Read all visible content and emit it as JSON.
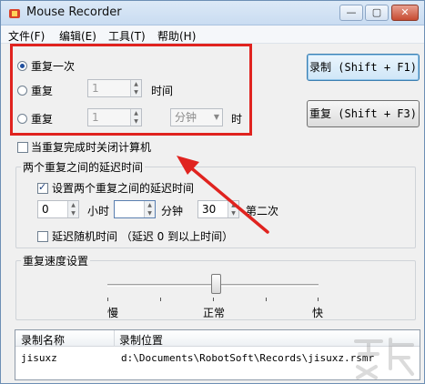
{
  "window": {
    "title": "Mouse Recorder",
    "buttons": {
      "min": "—",
      "max": "▢",
      "close": "✕"
    }
  },
  "menu": [
    "文件(F)",
    "编辑(E)",
    "工具(T)",
    "帮助(H)"
  ],
  "repeat": {
    "once_label": "重复一次",
    "times_label": "重复",
    "times_value": "1",
    "times_unit": "时间",
    "duration_label": "重复",
    "duration_value": "1",
    "duration_unit_option": "分钟",
    "duration_suffix": "时"
  },
  "buttons": {
    "record": "录制 (Shift + F1)",
    "repeat": "重复 (Shift + F3)"
  },
  "shutdown_label": "当重复完成时关闭计算机",
  "delay_group": {
    "title": "两个重复之间的延迟时间",
    "set_delay_label": "设置两个重复之间的延迟时间",
    "hours_value": "0",
    "hours_label": "小时",
    "minutes_value": "",
    "minutes_label": "分钟",
    "seconds_value": "30",
    "seconds_label": "第二次",
    "random_label": "延迟随机时间 （延迟 0 到以上时间）"
  },
  "speed_group": {
    "title": "重复速度设置",
    "slow": "慢",
    "normal": "正常",
    "fast": "快",
    "level": 0.5
  },
  "list": {
    "columns": [
      "录制名称",
      "录制位置"
    ],
    "rows": [
      {
        "name": "jisuxz",
        "path": "d:\\Documents\\RobotSoft\\Records\\jisuxz.rsmr"
      }
    ]
  },
  "colors": {
    "highlight": "#e0231f",
    "titlebar": "#c9dcf1"
  }
}
